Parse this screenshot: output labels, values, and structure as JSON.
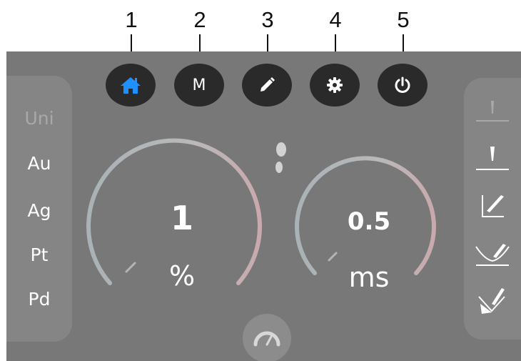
{
  "callouts": [
    "1",
    "2",
    "3",
    "4",
    "5"
  ],
  "topbar": {
    "home_icon": "home-icon",
    "memory_label": "M",
    "edit_icon": "pencil-icon",
    "settings_icon": "gear-icon",
    "power_icon": "power-icon",
    "accent_color": "#1e90ff"
  },
  "alloys": [
    {
      "label": "Uni",
      "active": false
    },
    {
      "label": "Au",
      "active": true
    },
    {
      "label": "Ag",
      "active": true
    },
    {
      "label": "Pt",
      "active": true
    },
    {
      "label": "Pd",
      "active": true
    }
  ],
  "weld_modes": [
    "tack-weld-icon",
    "spot-weld-icon",
    "corner-weld-icon",
    "fillet-weld-icon",
    "butt-weld-icon"
  ],
  "gauges": {
    "power": {
      "value": "1",
      "unit": "%"
    },
    "duration": {
      "value": "0.5",
      "unit": "ms"
    }
  },
  "footswitch_icon": "footprint-icon",
  "speed_icon": "speedometer-icon"
}
